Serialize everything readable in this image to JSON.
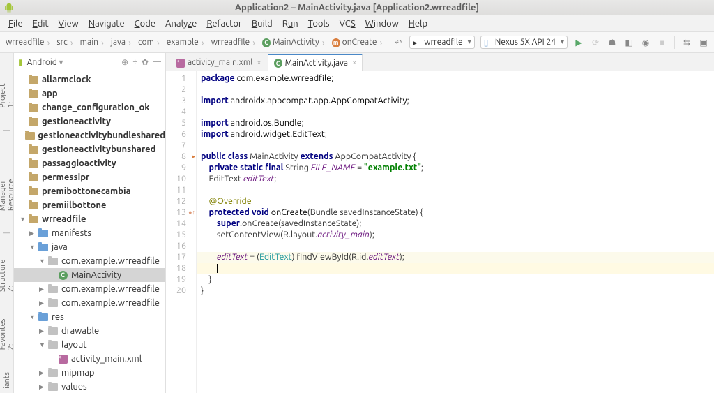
{
  "title": "Application2 – MainActivity.java [Application2.wrreadfile]",
  "menu": [
    "File",
    "Edit",
    "View",
    "Navigate",
    "Code",
    "Analyze",
    "Refactor",
    "Build",
    "Run",
    "Tools",
    "VCS",
    "Window",
    "Help"
  ],
  "breadcrumbs": [
    "wrreadfile",
    "src",
    "main",
    "java",
    "com",
    "example",
    "wrreadfile",
    "MainActivity",
    "onCreate"
  ],
  "run_config": "wrreadfile",
  "device": "Nexus 5X API 24",
  "sidebar_tabs": [
    "1: Project",
    "Resource Manager",
    "Z: Structure",
    "2: Favorites",
    "iants"
  ],
  "project_header": "Android",
  "project_tree": [
    {
      "level": 0,
      "arrow": "",
      "icon": "app",
      "label": "allarmclock",
      "bold": true
    },
    {
      "level": 0,
      "arrow": "",
      "icon": "app",
      "label": "app",
      "bold": true
    },
    {
      "level": 0,
      "arrow": "",
      "icon": "app",
      "label": "change_configuration_ok",
      "bold": true
    },
    {
      "level": 0,
      "arrow": "",
      "icon": "app",
      "label": "gestioneactivity",
      "bold": true
    },
    {
      "level": 0,
      "arrow": "",
      "icon": "app",
      "label": "gestioneactivitybundleshared",
      "bold": true
    },
    {
      "level": 0,
      "arrow": "",
      "icon": "app",
      "label": "gestioneactivitybunshared",
      "bold": true
    },
    {
      "level": 0,
      "arrow": "",
      "icon": "app",
      "label": "passaggioactivity",
      "bold": true
    },
    {
      "level": 0,
      "arrow": "",
      "icon": "app",
      "label": "permessipr",
      "bold": true
    },
    {
      "level": 0,
      "arrow": "",
      "icon": "app",
      "label": "premibottonecambia",
      "bold": true
    },
    {
      "level": 0,
      "arrow": "",
      "icon": "app",
      "label": "premiilbottone",
      "bold": true
    },
    {
      "level": 0,
      "arrow": "▼",
      "icon": "app",
      "label": "wrreadfile",
      "bold": true
    },
    {
      "level": 1,
      "arrow": "▶",
      "icon": "folder-blue",
      "label": "manifests"
    },
    {
      "level": 1,
      "arrow": "▼",
      "icon": "folder-blue",
      "label": "java"
    },
    {
      "level": 2,
      "arrow": "▼",
      "icon": "folder-grey",
      "label": "com.example.wrreadfile"
    },
    {
      "level": 3,
      "arrow": "",
      "icon": "class",
      "label": "MainActivity",
      "selected": true
    },
    {
      "level": 2,
      "arrow": "▶",
      "icon": "folder-grey",
      "label": "com.example.wrreadfile"
    },
    {
      "level": 2,
      "arrow": "▶",
      "icon": "folder-grey",
      "label": "com.example.wrreadfile"
    },
    {
      "level": 1,
      "arrow": "▼",
      "icon": "folder-blue",
      "label": "res"
    },
    {
      "level": 2,
      "arrow": "▶",
      "icon": "folder-grey",
      "label": "drawable"
    },
    {
      "level": 2,
      "arrow": "▼",
      "icon": "folder-grey",
      "label": "layout"
    },
    {
      "level": 3,
      "arrow": "",
      "icon": "xml",
      "label": "activity_main.xml"
    },
    {
      "level": 2,
      "arrow": "▶",
      "icon": "folder-grey",
      "label": "mipmap"
    },
    {
      "level": 2,
      "arrow": "▶",
      "icon": "folder-grey",
      "label": "values"
    }
  ],
  "editor_tabs": [
    {
      "icon": "xml",
      "label": "activity_main.xml",
      "active": false
    },
    {
      "icon": "class",
      "label": "MainActivity.java",
      "active": true
    }
  ],
  "code": {
    "package": "package",
    "pkg_name": "com.example.wrreadfile",
    "import": "import",
    "imp1": "androidx.appcompat.app.AppCompatActivity",
    "imp2": "android.os.Bundle",
    "imp3": "android.widget.EditText",
    "public": "public",
    "class": "class",
    "cls_name": "MainActivity",
    "extends": "extends",
    "parent": "AppCompatActivity",
    "private": "private",
    "static": "static",
    "final": "final",
    "str_t": "String",
    "const": "FILE_NAME",
    "const_v": "\"example.txt\"",
    "et_t": "EditText",
    "et_f": "editText",
    "ann": "@Override",
    "protected": "protected",
    "void": "void",
    "onc": "onCreate",
    "bundle": "Bundle",
    "arg": "savedInstanceState",
    "super": "super",
    "setcv": "setContentView",
    "rlay": "R.layout.",
    "actmain": "activity_main",
    "find": "findViewById",
    "rid": "R.id.",
    "etid": "editText",
    "eq": " = ",
    "cast_l": "(",
    "cast_r": ")"
  },
  "line_numbers": [
    1,
    2,
    3,
    4,
    5,
    6,
    7,
    8,
    9,
    10,
    11,
    12,
    13,
    14,
    15,
    16,
    17,
    18,
    19,
    20
  ]
}
